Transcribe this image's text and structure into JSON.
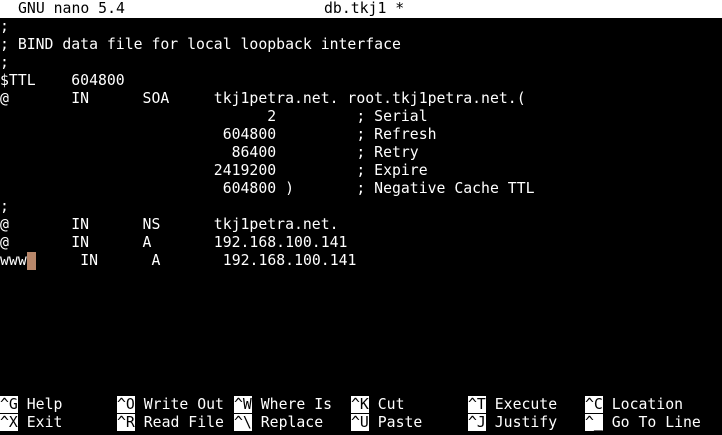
{
  "titlebar": {
    "app": "GNU nano 5.4",
    "filename": "db.tkj1 *"
  },
  "editor": {
    "lines": [
      ";",
      "; BIND data file for local loopback interface",
      ";",
      "$TTL    604800",
      "@       IN      SOA     tkj1petra.net. root.tkj1petra.net.(",
      "                              2         ; Serial",
      "                         604800         ; Refresh",
      "                          86400         ; Retry",
      "                        2419200         ; Expire",
      "                         604800 )       ; Negative Cache TTL",
      ";",
      "@       IN      NS      tkj1petra.net.",
      "@       IN      A       192.168.100.141"
    ],
    "cursor_line": {
      "before": "www",
      "after": "     IN      A       192.168.100.141"
    }
  },
  "shortcuts": {
    "row1": [
      {
        "key": "^G",
        "label": "Help"
      },
      {
        "key": "^O",
        "label": "Write Out"
      },
      {
        "key": "^W",
        "label": "Where Is"
      },
      {
        "key": "^K",
        "label": "Cut"
      },
      {
        "key": "^T",
        "label": "Execute"
      },
      {
        "key": "^C",
        "label": "Location"
      }
    ],
    "row2": [
      {
        "key": "^X",
        "label": "Exit"
      },
      {
        "key": "^R",
        "label": "Read File"
      },
      {
        "key": "^\\",
        "label": "Replace"
      },
      {
        "key": "^U",
        "label": "Paste"
      },
      {
        "key": "^J",
        "label": "Justify"
      },
      {
        "key": "^_",
        "label": "Go To Line"
      }
    ]
  }
}
